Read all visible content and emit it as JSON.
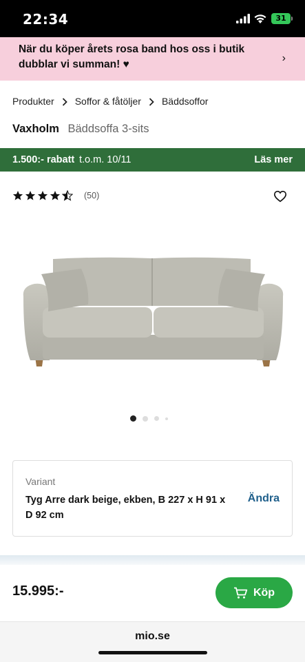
{
  "status_bar": {
    "time": "22:34",
    "battery": "31"
  },
  "promo": {
    "text": "När du köper årets rosa band hos oss i butik dubblar vi summan! ♥",
    "chevron": "›"
  },
  "breadcrumb": [
    "Produkter",
    "Soffor & fåtöljer",
    "Bäddsoffor"
  ],
  "product": {
    "brand": "Vaxholm",
    "name": "Bäddsoffa 3-sits"
  },
  "discount": {
    "amount": "1.500:- rabatt",
    "until": "t.o.m. 10/11",
    "link": "Läs mer",
    "color": "#2f6e3a"
  },
  "rating": {
    "stars": 4.5,
    "max": 5,
    "count": "(50)"
  },
  "gallery": {
    "image": "sofa-image",
    "count": 4,
    "active": 0
  },
  "variant": {
    "label": "Variant",
    "value": "Tyg Arre dark beige, ekben, B 227 x H 91 x D 92 cm",
    "change_label": "Ändra"
  },
  "purchase": {
    "price": "15.995:-",
    "buy_label": "Köp",
    "button_color": "#2aa845"
  },
  "browser": {
    "url": "mio.se"
  }
}
